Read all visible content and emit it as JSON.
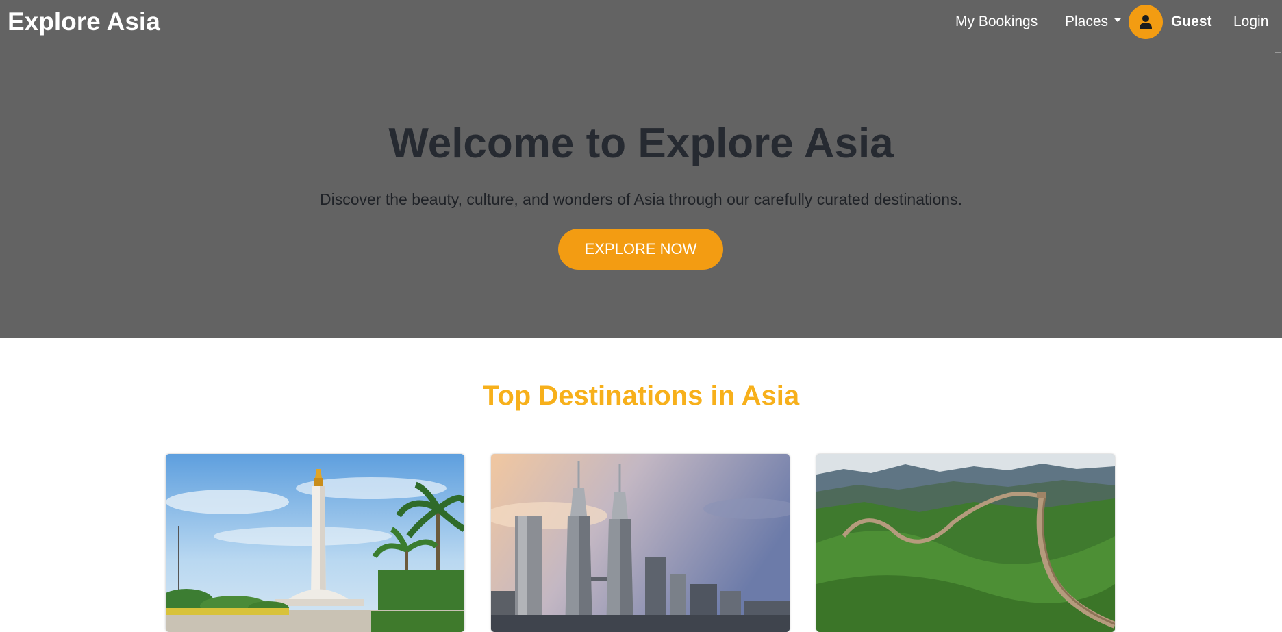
{
  "nav": {
    "brand": "Explore Asia",
    "my_bookings": "My Bookings",
    "places": "Places",
    "user_name": "Guest",
    "login": "Login"
  },
  "hero": {
    "title": "Welcome to Explore Asia",
    "subtitle": "Discover the beauty, culture, and wonders of Asia through our carefully curated destinations.",
    "cta_label": "EXPLORE NOW"
  },
  "destinations": {
    "title": "Top Destinations in Asia",
    "cards": [
      {
        "image": "national-monument-tower-photo"
      },
      {
        "image": "twin-towers-skyline-photo"
      },
      {
        "image": "great-wall-mountains-photo"
      }
    ]
  },
  "colors": {
    "accent": "#f39c12",
    "section_title": "#f7b01b",
    "hero_bg": "#636363"
  },
  "icons": {
    "avatar": "user-icon",
    "places_dropdown": "caret-down-icon"
  }
}
